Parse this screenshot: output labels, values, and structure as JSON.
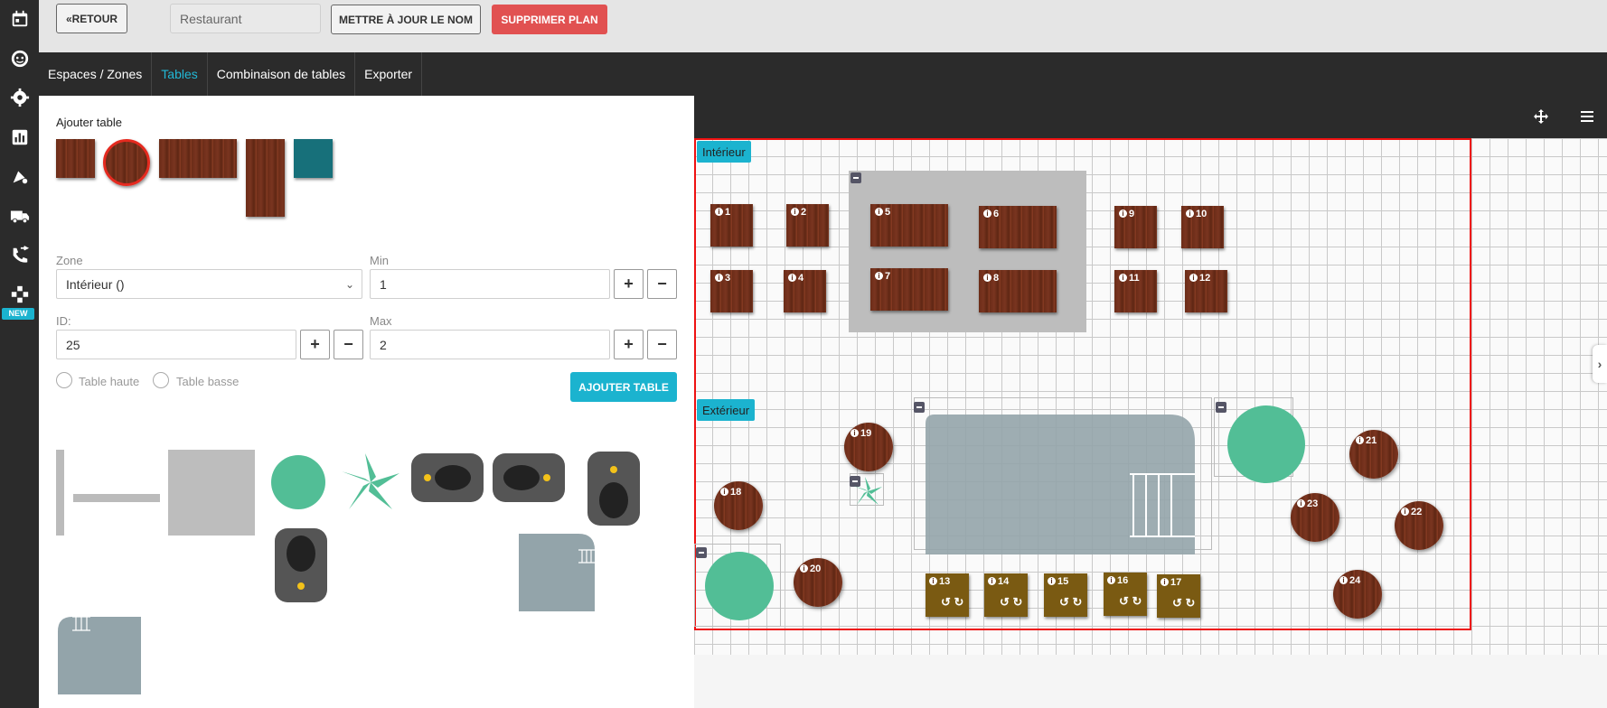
{
  "sidebar": {
    "icons": [
      "calendar-icon",
      "face-icon",
      "gear-icon",
      "chart-icon",
      "marketing-icon",
      "truck-icon",
      "phone-transfer-icon",
      "gamepad-icon"
    ],
    "new_badge": "NEW"
  },
  "topbar": {
    "back_label": "«RETOUR",
    "plan_name_value": "Restaurant",
    "update_label": "METTRE À JOUR LE NOM",
    "delete_label": "SUPPRIMER PLAN"
  },
  "tabs": [
    {
      "label": "Espaces / Zones",
      "active": false
    },
    {
      "label": "Tables",
      "active": true
    },
    {
      "label": "Combinaison de tables",
      "active": false
    },
    {
      "label": "Exporter",
      "active": false
    }
  ],
  "form": {
    "title": "Ajouter table",
    "zone_label": "Zone",
    "zone_value": "Intérieur ()",
    "min_label": "Min",
    "min_value": "1",
    "id_label": "ID:",
    "id_value": "25",
    "max_label": "Max",
    "max_value": "2",
    "plus": "+",
    "minus": "−",
    "high_table_label": "Table haute",
    "low_table_label": "Table basse",
    "add_button": "AJOUTER TABLE"
  },
  "zones": [
    {
      "name": "Intérieur"
    },
    {
      "name": "Extérieur"
    }
  ],
  "tables": {
    "interior": [
      "1",
      "2",
      "3",
      "4",
      "5",
      "6",
      "7",
      "8",
      "9",
      "10",
      "11",
      "12"
    ],
    "exterior_round": [
      "18",
      "19",
      "20",
      "21",
      "22",
      "23",
      "24"
    ],
    "exterior_gold": [
      "13",
      "14",
      "15",
      "16",
      "17"
    ]
  },
  "canvas_toolbar": {
    "move_icon": "move-icon",
    "menu_icon": "menu-icon"
  },
  "colors": {
    "accent": "#1bb3cf",
    "danger": "#e15151",
    "dark": "#2b2b2b",
    "zone_border": "#ee1111",
    "wood": "#6b2c17",
    "gold_table": "#7a5a12",
    "plant": "#52be96"
  }
}
